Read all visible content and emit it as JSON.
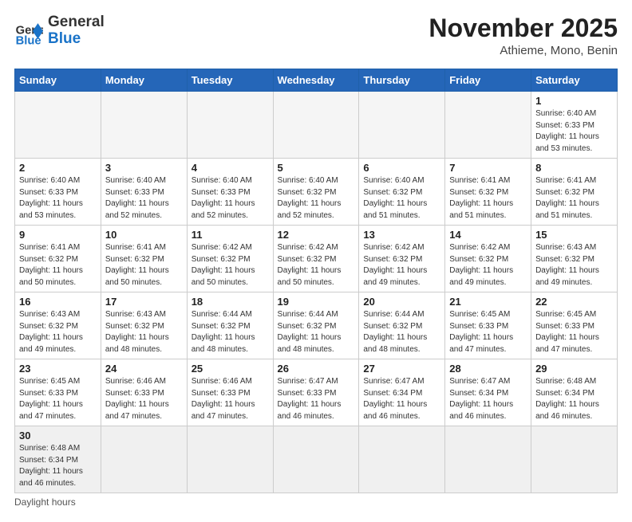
{
  "header": {
    "logo_general": "General",
    "logo_blue": "Blue",
    "month_title": "November 2025",
    "location": "Athieme, Mono, Benin"
  },
  "weekdays": [
    "Sunday",
    "Monday",
    "Tuesday",
    "Wednesday",
    "Thursday",
    "Friday",
    "Saturday"
  ],
  "weeks": [
    [
      {
        "day": null,
        "info": null
      },
      {
        "day": null,
        "info": null
      },
      {
        "day": null,
        "info": null
      },
      {
        "day": null,
        "info": null
      },
      {
        "day": null,
        "info": null
      },
      {
        "day": null,
        "info": null
      },
      {
        "day": "1",
        "info": "Sunrise: 6:40 AM\nSunset: 6:33 PM\nDaylight: 11 hours\nand 53 minutes."
      }
    ],
    [
      {
        "day": "2",
        "info": "Sunrise: 6:40 AM\nSunset: 6:33 PM\nDaylight: 11 hours\nand 53 minutes."
      },
      {
        "day": "3",
        "info": "Sunrise: 6:40 AM\nSunset: 6:33 PM\nDaylight: 11 hours\nand 52 minutes."
      },
      {
        "day": "4",
        "info": "Sunrise: 6:40 AM\nSunset: 6:33 PM\nDaylight: 11 hours\nand 52 minutes."
      },
      {
        "day": "5",
        "info": "Sunrise: 6:40 AM\nSunset: 6:32 PM\nDaylight: 11 hours\nand 52 minutes."
      },
      {
        "day": "6",
        "info": "Sunrise: 6:40 AM\nSunset: 6:32 PM\nDaylight: 11 hours\nand 51 minutes."
      },
      {
        "day": "7",
        "info": "Sunrise: 6:41 AM\nSunset: 6:32 PM\nDaylight: 11 hours\nand 51 minutes."
      },
      {
        "day": "8",
        "info": "Sunrise: 6:41 AM\nSunset: 6:32 PM\nDaylight: 11 hours\nand 51 minutes."
      }
    ],
    [
      {
        "day": "9",
        "info": "Sunrise: 6:41 AM\nSunset: 6:32 PM\nDaylight: 11 hours\nand 50 minutes."
      },
      {
        "day": "10",
        "info": "Sunrise: 6:41 AM\nSunset: 6:32 PM\nDaylight: 11 hours\nand 50 minutes."
      },
      {
        "day": "11",
        "info": "Sunrise: 6:42 AM\nSunset: 6:32 PM\nDaylight: 11 hours\nand 50 minutes."
      },
      {
        "day": "12",
        "info": "Sunrise: 6:42 AM\nSunset: 6:32 PM\nDaylight: 11 hours\nand 50 minutes."
      },
      {
        "day": "13",
        "info": "Sunrise: 6:42 AM\nSunset: 6:32 PM\nDaylight: 11 hours\nand 49 minutes."
      },
      {
        "day": "14",
        "info": "Sunrise: 6:42 AM\nSunset: 6:32 PM\nDaylight: 11 hours\nand 49 minutes."
      },
      {
        "day": "15",
        "info": "Sunrise: 6:43 AM\nSunset: 6:32 PM\nDaylight: 11 hours\nand 49 minutes."
      }
    ],
    [
      {
        "day": "16",
        "info": "Sunrise: 6:43 AM\nSunset: 6:32 PM\nDaylight: 11 hours\nand 49 minutes."
      },
      {
        "day": "17",
        "info": "Sunrise: 6:43 AM\nSunset: 6:32 PM\nDaylight: 11 hours\nand 48 minutes."
      },
      {
        "day": "18",
        "info": "Sunrise: 6:44 AM\nSunset: 6:32 PM\nDaylight: 11 hours\nand 48 minutes."
      },
      {
        "day": "19",
        "info": "Sunrise: 6:44 AM\nSunset: 6:32 PM\nDaylight: 11 hours\nand 48 minutes."
      },
      {
        "day": "20",
        "info": "Sunrise: 6:44 AM\nSunset: 6:32 PM\nDaylight: 11 hours\nand 48 minutes."
      },
      {
        "day": "21",
        "info": "Sunrise: 6:45 AM\nSunset: 6:33 PM\nDaylight: 11 hours\nand 47 minutes."
      },
      {
        "day": "22",
        "info": "Sunrise: 6:45 AM\nSunset: 6:33 PM\nDaylight: 11 hours\nand 47 minutes."
      }
    ],
    [
      {
        "day": "23",
        "info": "Sunrise: 6:45 AM\nSunset: 6:33 PM\nDaylight: 11 hours\nand 47 minutes."
      },
      {
        "day": "24",
        "info": "Sunrise: 6:46 AM\nSunset: 6:33 PM\nDaylight: 11 hours\nand 47 minutes."
      },
      {
        "day": "25",
        "info": "Sunrise: 6:46 AM\nSunset: 6:33 PM\nDaylight: 11 hours\nand 47 minutes."
      },
      {
        "day": "26",
        "info": "Sunrise: 6:47 AM\nSunset: 6:33 PM\nDaylight: 11 hours\nand 46 minutes."
      },
      {
        "day": "27",
        "info": "Sunrise: 6:47 AM\nSunset: 6:34 PM\nDaylight: 11 hours\nand 46 minutes."
      },
      {
        "day": "28",
        "info": "Sunrise: 6:47 AM\nSunset: 6:34 PM\nDaylight: 11 hours\nand 46 minutes."
      },
      {
        "day": "29",
        "info": "Sunrise: 6:48 AM\nSunset: 6:34 PM\nDaylight: 11 hours\nand 46 minutes."
      }
    ],
    [
      {
        "day": "30",
        "info": "Sunrise: 6:48 AM\nSunset: 6:34 PM\nDaylight: 11 hours\nand 46 minutes.",
        "last": true
      },
      {
        "day": null,
        "info": null,
        "last": true
      },
      {
        "day": null,
        "info": null,
        "last": true
      },
      {
        "day": null,
        "info": null,
        "last": true
      },
      {
        "day": null,
        "info": null,
        "last": true
      },
      {
        "day": null,
        "info": null,
        "last": true
      },
      {
        "day": null,
        "info": null,
        "last": true
      }
    ]
  ],
  "footer": {
    "daylight_label": "Daylight hours"
  }
}
